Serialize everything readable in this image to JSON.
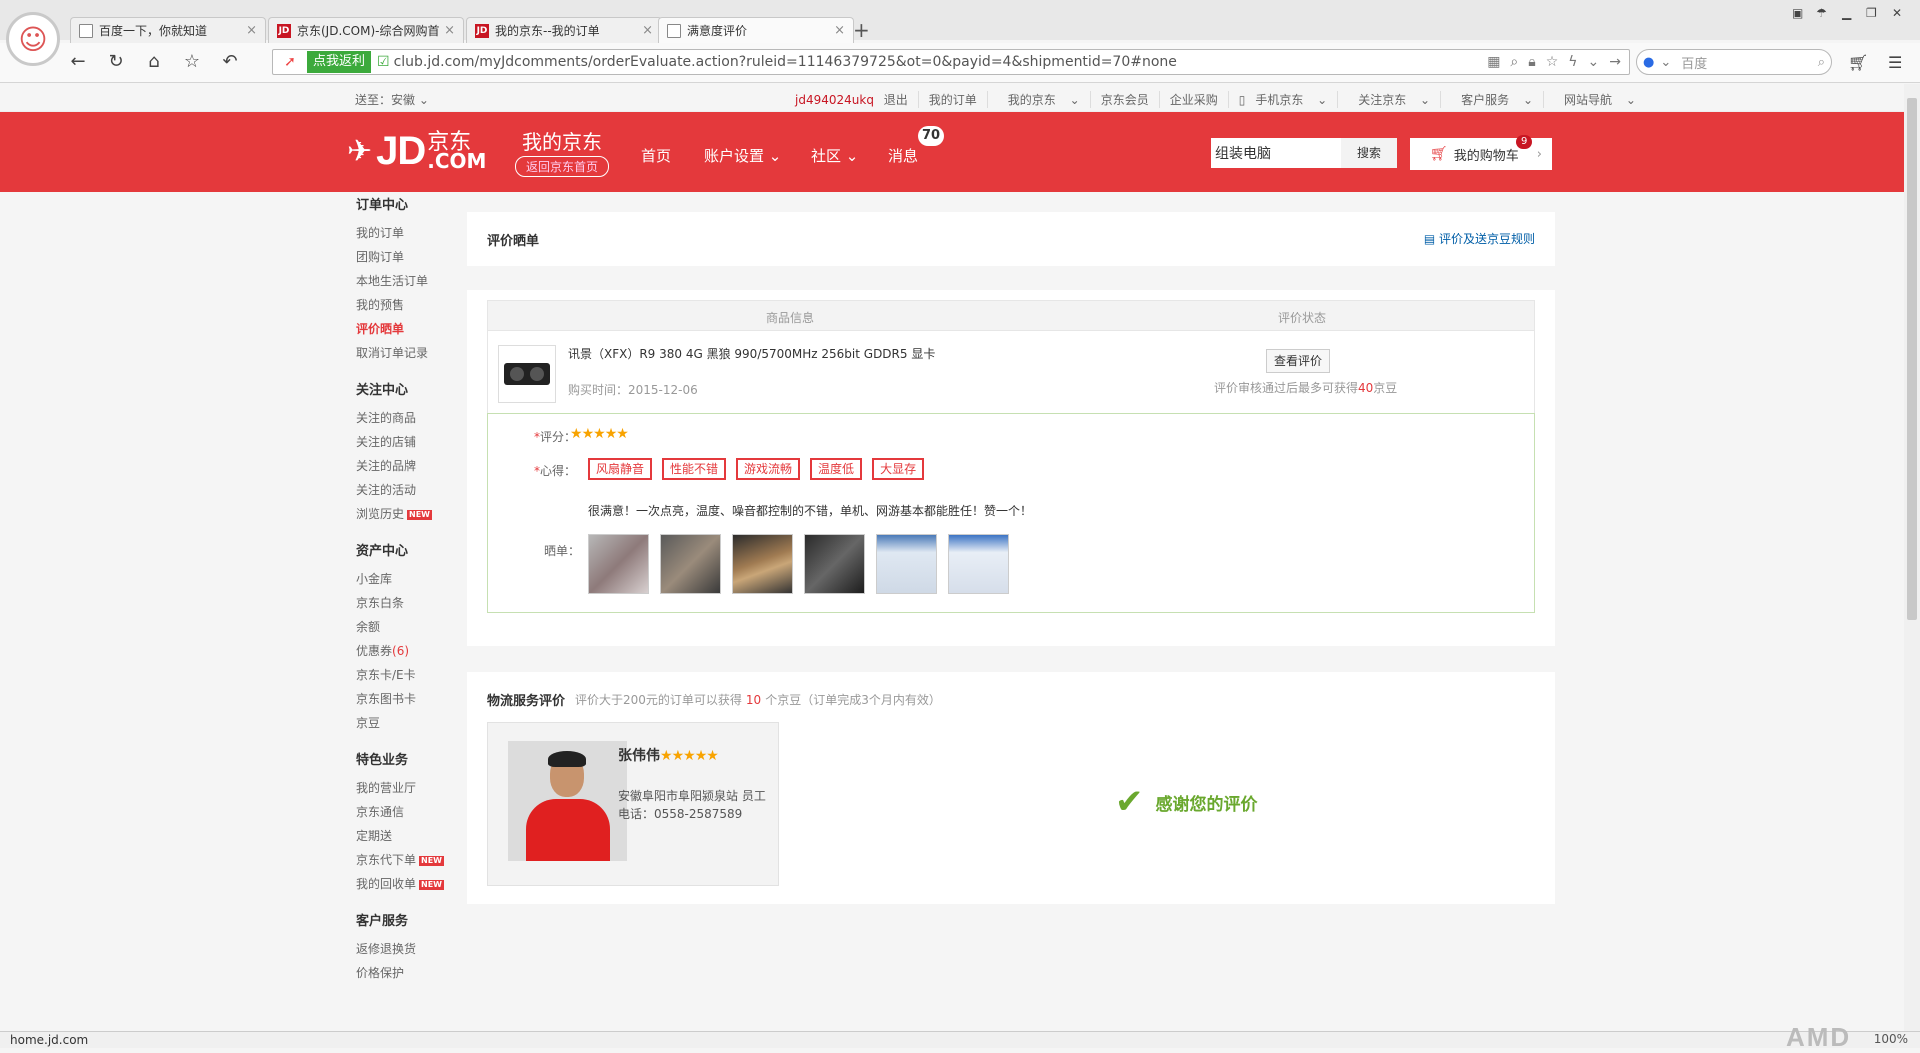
{
  "browser": {
    "tabs": [
      {
        "label": "百度一下，你就知道",
        "icon": "page-icon"
      },
      {
        "label": "京东(JD.COM)-综合网购首",
        "icon": "jd-icon"
      },
      {
        "label": "我的京东--我的订单",
        "icon": "jd-icon"
      },
      {
        "label": "满意度评价",
        "icon": "page-icon",
        "active": true
      }
    ],
    "fanli_label": "点我返利",
    "url": "club.jd.com/myJdcomments/orderEvaluate.action?ruleid=11146379725&ot=0&payid=4&shipmentid=70#none",
    "search_placeholder": "百度"
  },
  "shortcut": {
    "location": "送至：安徽",
    "user": "jd494024ukq",
    "logout": "退出",
    "links": [
      "我的订单",
      "我的京东",
      "京东会员",
      "企业采购",
      "手机京东",
      "关注京东",
      "客户服务",
      "网站导航"
    ]
  },
  "header": {
    "logo_jd": "JD",
    "logo_cn": "京东",
    "logo_com": ".COM",
    "my_jd": "我的京东",
    "back_home": "返回京东首页",
    "nav": [
      "首页",
      "账户设置",
      "社区",
      "消息"
    ],
    "msg_count": "70",
    "search_value": "组装电脑",
    "search_button": "搜索",
    "cart_label": "我的购物车",
    "cart_count": "9"
  },
  "sidebar": [
    {
      "title": "订单中心",
      "items": [
        {
          "label": "我的订单"
        },
        {
          "label": "团购订单"
        },
        {
          "label": "本地生活订单"
        },
        {
          "label": "我的预售"
        },
        {
          "label": "评价晒单",
          "active": true
        },
        {
          "label": "取消订单记录"
        }
      ]
    },
    {
      "title": "关注中心",
      "items": [
        {
          "label": "关注的商品"
        },
        {
          "label": "关注的店铺"
        },
        {
          "label": "关注的品牌"
        },
        {
          "label": "关注的活动"
        },
        {
          "label": "浏览历史",
          "new": true
        }
      ]
    },
    {
      "title": "资产中心",
      "items": [
        {
          "label": "小金库"
        },
        {
          "label": "京东白条"
        },
        {
          "label": "余额"
        },
        {
          "label": "优惠券",
          "count": "(6)"
        },
        {
          "label": "京东卡/E卡"
        },
        {
          "label": "京东图书卡"
        },
        {
          "label": "京豆"
        }
      ]
    },
    {
      "title": "特色业务",
      "items": [
        {
          "label": "我的营业厅"
        },
        {
          "label": "京东通信"
        },
        {
          "label": "定期送"
        },
        {
          "label": "京东代下单",
          "new": true
        },
        {
          "label": "我的回收单",
          "new": true
        }
      ]
    },
    {
      "title": "客户服务",
      "items": [
        {
          "label": "返修退换货"
        },
        {
          "label": "价格保护"
        }
      ]
    }
  ],
  "new_tag": "NEW",
  "review": {
    "section_title": "评价晒单",
    "rules_link": "评价及送京豆规则",
    "col_product": "商品信息",
    "col_status": "评价状态",
    "product_name": "讯景（XFX）R9 380 4G 黑狼 990/5700MHz 256bit GDDR5 显卡",
    "purchase_time_label": "购买时间：",
    "purchase_time": "2015-12-06",
    "view_button": "查看评价",
    "tip_prefix": "评价审核通过后最多可获得",
    "tip_beans": "40",
    "tip_suffix": "京豆",
    "rating_label": "评分：",
    "rating": 5,
    "experience_label": "心得：",
    "tags": [
      "风扇静音",
      "性能不错",
      "游戏流畅",
      "温度低",
      "大显存"
    ],
    "comment": "很满意！一次点亮，温度、噪音都控制的不错，单机、网游基本都能胜任！赞一个！",
    "photos_label": "晒单：",
    "photos": [
      "photo-1",
      "photo-2",
      "photo-3",
      "photo-4",
      "photo-5",
      "photo-6"
    ]
  },
  "logistics": {
    "title": "物流服务评价",
    "sub_prefix": "评价大于200元的订单可以获得",
    "sub_beans": "10",
    "sub_suffix": "个京豆（订单完成3个月内有效）",
    "courier_name": "张伟伟",
    "courier_rating": 5,
    "courier_station": "安徽阜阳市阜阳颍泉站 员工",
    "courier_phone": "电话：0558-2587589",
    "thanks": "感谢您的评价"
  },
  "status": {
    "hover_url": "home.jd.com",
    "zoom": "100%",
    "watermark": "AMD"
  },
  "colors": {
    "jd_red": "#e4393c",
    "link_blue": "#005ea7",
    "thanks_green": "#6aa82e"
  }
}
